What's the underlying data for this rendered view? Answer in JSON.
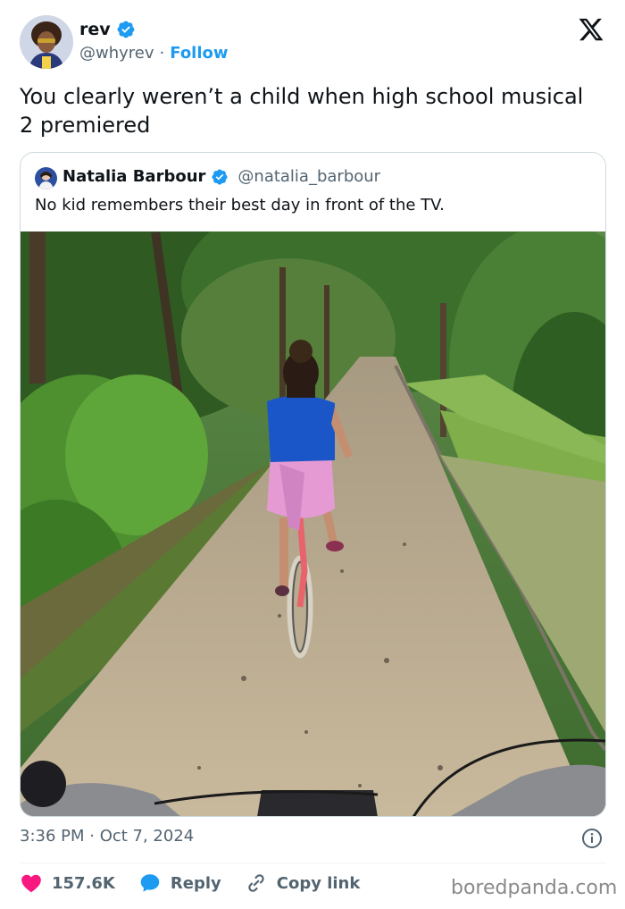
{
  "author": {
    "name": "rev",
    "handle": "@whyrev",
    "separator": "·",
    "follow_label": "Follow"
  },
  "tweet": {
    "text": "You clearly weren’t a child when high school musical 2 premiered"
  },
  "quoted": {
    "name": "Natalia Barbour",
    "handle": "@natalia_barbour",
    "text": "No kid remembers their best day in front of the TV."
  },
  "meta": {
    "timestamp": "3:36 PM · Oct 7, 2024"
  },
  "actions": {
    "like_count": "157.6K",
    "reply_label": "Reply",
    "copy_label": "Copy link"
  },
  "watermark": "boredpanda.com",
  "colors": {
    "accent": "#1d9bf0",
    "like": "#f91880",
    "text": "#0f1419",
    "muted": "#536471",
    "border": "#cfd9de"
  },
  "icons": {
    "verified": "verified-badge-icon",
    "logo": "x-logo-icon",
    "info": "info-icon",
    "like": "heart-icon",
    "reply": "speech-bubble-icon",
    "copy": "link-icon"
  }
}
